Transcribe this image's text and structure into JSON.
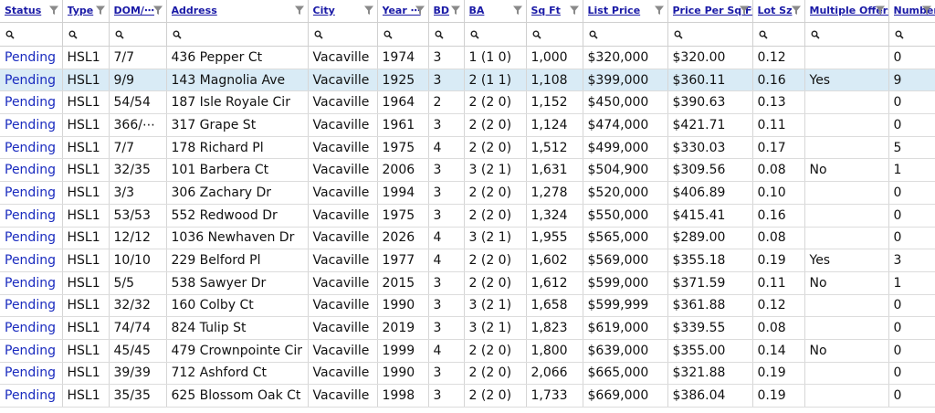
{
  "columns": [
    {
      "key": "status",
      "label": "Status"
    },
    {
      "key": "type",
      "label": "Type"
    },
    {
      "key": "dom",
      "label": "DOM/⋯"
    },
    {
      "key": "address",
      "label": "Address"
    },
    {
      "key": "city",
      "label": "City"
    },
    {
      "key": "year",
      "label": "Year ⋯"
    },
    {
      "key": "bd",
      "label": "BD"
    },
    {
      "key": "ba",
      "label": "BA"
    },
    {
      "key": "sqft",
      "label": "Sq Ft"
    },
    {
      "key": "list_price",
      "label": "List Price"
    },
    {
      "key": "ppsf",
      "label": "Price Per Sq Ft"
    },
    {
      "key": "lot",
      "label": "Lot Sz"
    },
    {
      "key": "offers",
      "label": "Multiple Offers"
    },
    {
      "key": "number",
      "label": "Number ⋯"
    }
  ],
  "rows": [
    {
      "status": "Pending",
      "type": "HSL1",
      "dom": "7/7",
      "address": "436 Pepper Ct",
      "city": "Vacaville",
      "year": "1974",
      "bd": "3",
      "ba": "1 (1 0)",
      "sqft": "1,000",
      "list_price": "$320,000",
      "ppsf": "$320.00",
      "lot": "0.12",
      "offers": "",
      "number": "0"
    },
    {
      "status": "Pending",
      "type": "HSL1",
      "dom": "9/9",
      "address": "143 Magnolia Ave",
      "city": "Vacaville",
      "year": "1925",
      "bd": "3",
      "ba": "2 (1 1)",
      "sqft": "1,108",
      "list_price": "$399,000",
      "ppsf": "$360.11",
      "lot": "0.16",
      "offers": "Yes",
      "number": "9",
      "selected": true
    },
    {
      "status": "Pending",
      "type": "HSL1",
      "dom": "54/54",
      "address": "187 Isle Royale Cir",
      "city": "Vacaville",
      "year": "1964",
      "bd": "2",
      "ba": "2 (2 0)",
      "sqft": "1,152",
      "list_price": "$450,000",
      "ppsf": "$390.63",
      "lot": "0.13",
      "offers": "",
      "number": "0"
    },
    {
      "status": "Pending",
      "type": "HSL1",
      "dom": "366/⋯",
      "address": "317 Grape St",
      "city": "Vacaville",
      "year": "1961",
      "bd": "3",
      "ba": "2 (2 0)",
      "sqft": "1,124",
      "list_price": "$474,000",
      "ppsf": "$421.71",
      "lot": "0.11",
      "offers": "",
      "number": "0"
    },
    {
      "status": "Pending",
      "type": "HSL1",
      "dom": "7/7",
      "address": "178 Richard Pl",
      "city": "Vacaville",
      "year": "1975",
      "bd": "4",
      "ba": "2 (2 0)",
      "sqft": "1,512",
      "list_price": "$499,000",
      "ppsf": "$330.03",
      "lot": "0.17",
      "offers": "",
      "number": "5"
    },
    {
      "status": "Pending",
      "type": "HSL1",
      "dom": "32/35",
      "address": "101 Barbera Ct",
      "city": "Vacaville",
      "year": "2006",
      "bd": "3",
      "ba": "3 (2 1)",
      "sqft": "1,631",
      "list_price": "$504,900",
      "ppsf": "$309.56",
      "lot": "0.08",
      "offers": "No",
      "number": "1"
    },
    {
      "status": "Pending",
      "type": "HSL1",
      "dom": "3/3",
      "address": "306 Zachary Dr",
      "city": "Vacaville",
      "year": "1994",
      "bd": "3",
      "ba": "2 (2 0)",
      "sqft": "1,278",
      "list_price": "$520,000",
      "ppsf": "$406.89",
      "lot": "0.10",
      "offers": "",
      "number": "0"
    },
    {
      "status": "Pending",
      "type": "HSL1",
      "dom": "53/53",
      "address": "552 Redwood Dr",
      "city": "Vacaville",
      "year": "1975",
      "bd": "3",
      "ba": "2 (2 0)",
      "sqft": "1,324",
      "list_price": "$550,000",
      "ppsf": "$415.41",
      "lot": "0.16",
      "offers": "",
      "number": "0"
    },
    {
      "status": "Pending",
      "type": "HSL1",
      "dom": "12/12",
      "address": "1036 Newhaven Dr",
      "city": "Vacaville",
      "year": "2026",
      "bd": "4",
      "ba": "3 (2 1)",
      "sqft": "1,955",
      "list_price": "$565,000",
      "ppsf": "$289.00",
      "lot": "0.08",
      "offers": "",
      "number": "0"
    },
    {
      "status": "Pending",
      "type": "HSL1",
      "dom": "10/10",
      "address": "229 Belford Pl",
      "city": "Vacaville",
      "year": "1977",
      "bd": "4",
      "ba": "2 (2 0)",
      "sqft": "1,602",
      "list_price": "$569,000",
      "ppsf": "$355.18",
      "lot": "0.19",
      "offers": "Yes",
      "number": "3"
    },
    {
      "status": "Pending",
      "type": "HSL1",
      "dom": "5/5",
      "address": "538 Sawyer Dr",
      "city": "Vacaville",
      "year": "2015",
      "bd": "3",
      "ba": "2 (2 0)",
      "sqft": "1,612",
      "list_price": "$599,000",
      "ppsf": "$371.59",
      "lot": "0.11",
      "offers": "No",
      "number": "1"
    },
    {
      "status": "Pending",
      "type": "HSL1",
      "dom": "32/32",
      "address": "160 Colby Ct",
      "city": "Vacaville",
      "year": "1990",
      "bd": "3",
      "ba": "3 (2 1)",
      "sqft": "1,658",
      "list_price": "$599,999",
      "ppsf": "$361.88",
      "lot": "0.12",
      "offers": "",
      "number": "0"
    },
    {
      "status": "Pending",
      "type": "HSL1",
      "dom": "74/74",
      "address": "824 Tulip St",
      "city": "Vacaville",
      "year": "2019",
      "bd": "3",
      "ba": "3 (2 1)",
      "sqft": "1,823",
      "list_price": "$619,000",
      "ppsf": "$339.55",
      "lot": "0.08",
      "offers": "",
      "number": "0"
    },
    {
      "status": "Pending",
      "type": "HSL1",
      "dom": "45/45",
      "address": "479 Crownpointe Cir",
      "city": "Vacaville",
      "year": "1999",
      "bd": "4",
      "ba": "2 (2 0)",
      "sqft": "1,800",
      "list_price": "$639,000",
      "ppsf": "$355.00",
      "lot": "0.14",
      "offers": "No",
      "number": "0"
    },
    {
      "status": "Pending",
      "type": "HSL1",
      "dom": "39/39",
      "address": "712 Ashford Ct",
      "city": "Vacaville",
      "year": "1990",
      "bd": "3",
      "ba": "2 (2 0)",
      "sqft": "2,066",
      "list_price": "$665,000",
      "ppsf": "$321.88",
      "lot": "0.19",
      "offers": "",
      "number": "0"
    },
    {
      "status": "Pending",
      "type": "HSL1",
      "dom": "35/35",
      "address": "625 Blossom Oak Ct",
      "city": "Vacaville",
      "year": "1998",
      "bd": "3",
      "ba": "2 (2 0)",
      "sqft": "1,733",
      "list_price": "$669,000",
      "ppsf": "$386.04",
      "lot": "0.19",
      "offers": "",
      "number": "0"
    }
  ],
  "colors": {
    "link": "#1a2bbf",
    "header_link": "#1a1aa6",
    "selected_row": "#d9ebf6",
    "grid": "#d0d0d0"
  },
  "icons": {
    "filter": "funnel-icon",
    "search": "search-icon"
  }
}
